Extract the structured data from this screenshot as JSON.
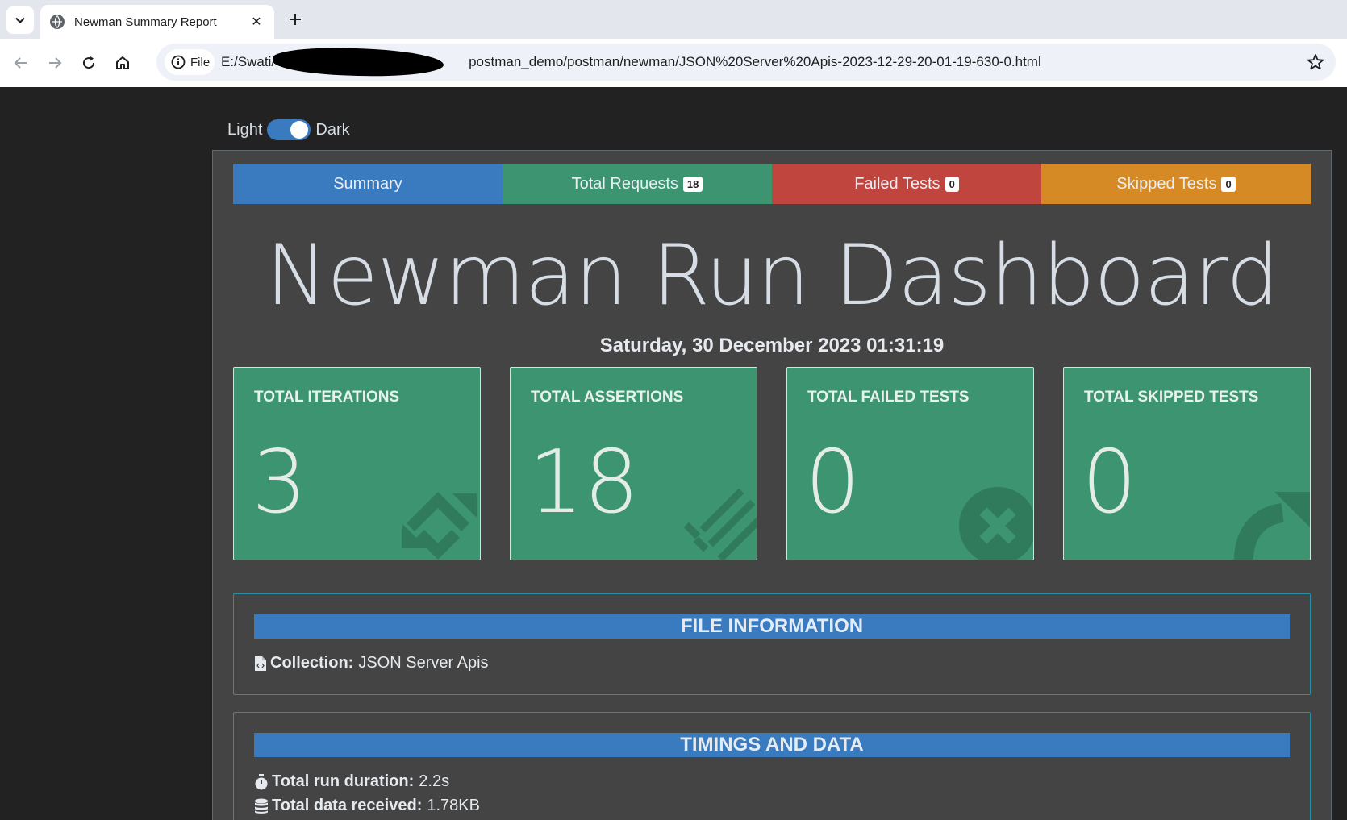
{
  "browser": {
    "tab_title": "Newman Summary Report",
    "site_chip_label": "File",
    "url_prefix": "E:/Swati/",
    "url_suffix": "postman_demo/postman/newman/JSON%20Server%20Apis-2023-12-29-20-01-19-630-0.html"
  },
  "theme_toggle": {
    "light_label": "Light",
    "dark_label": "Dark",
    "state": "dark"
  },
  "nav_tabs": [
    {
      "label": "Summary",
      "badge": null,
      "color": "#3a7bbf"
    },
    {
      "label": "Total Requests",
      "badge": "18",
      "color": "#3d9470"
    },
    {
      "label": "Failed Tests",
      "badge": "0",
      "color": "#c0453e"
    },
    {
      "label": "Skipped Tests",
      "badge": "0",
      "color": "#d58a25"
    }
  ],
  "dashboard": {
    "title": "Newman Run Dashboard",
    "date": "Saturday, 30 December 2023 01:31:19"
  },
  "stats": [
    {
      "label": "TOTAL ITERATIONS",
      "value": "3",
      "icon": "sync-icon"
    },
    {
      "label": "TOTAL ASSERTIONS",
      "value": "18",
      "icon": "check-list-icon"
    },
    {
      "label": "TOTAL FAILED TESTS",
      "value": "0",
      "icon": "times-circle-icon"
    },
    {
      "label": "TOTAL SKIPPED TESTS",
      "value": "0",
      "icon": "share-arrow-icon"
    }
  ],
  "file_info": {
    "header": "FILE INFORMATION",
    "collection_label": "Collection:",
    "collection_value": "JSON Server Apis"
  },
  "timings": {
    "header": "TIMINGS AND DATA",
    "duration_label": "Total run duration:",
    "duration_value": "2.2s",
    "data_label": "Total data received:",
    "data_value": "1.78KB"
  }
}
